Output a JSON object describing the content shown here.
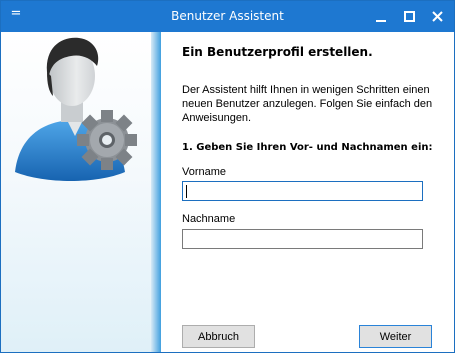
{
  "window": {
    "title": "Benutzer Assistent",
    "system_menu_glyph": "=",
    "accent_color": "#1e78d1",
    "controls": {
      "minimize_icon": "minimize-icon",
      "maximize_icon": "maximize-icon",
      "close_icon": "close-icon"
    }
  },
  "illustration": {
    "icon": "user-gear-icon"
  },
  "content": {
    "heading": "Ein Benutzerprofil erstellen.",
    "intro": "Der Assistent hilft Ihnen in wenigen Schritten einen neuen Benutzer anzulegen. Folgen Sie einfach den Anweisungen.",
    "step_title": "1. Geben Sie Ihren Vor- und Nachnamen ein:",
    "first_name": {
      "label": "Vorname",
      "value": ""
    },
    "last_name": {
      "label": "Nachname",
      "value": ""
    }
  },
  "buttons": {
    "cancel": "Abbruch",
    "next": "Weiter"
  }
}
